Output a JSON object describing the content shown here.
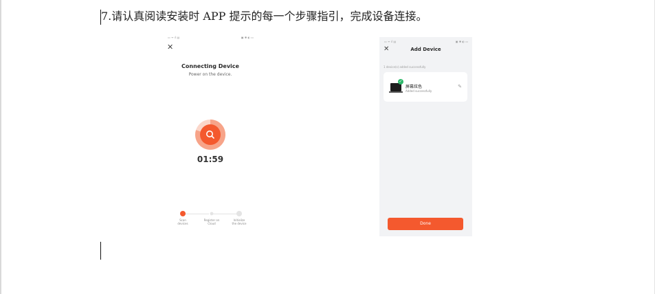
{
  "instruction": "7.请认真阅读安装时 APP 提示的每一个步骤指引，完成设备连接。",
  "left_screen": {
    "status_left": "▭ ᯤ ıl ▤",
    "status_right": "▣ ✱ ◐ ▭",
    "close_icon": "close-icon",
    "title": "Connecting Device",
    "subtitle": "Power on the device.",
    "search_icon": "search-icon",
    "timer": "01:59",
    "progress_ring_fraction": 0.8,
    "steps": [
      {
        "label": "Scan\ndevices",
        "state": "active"
      },
      {
        "label": "Register on\nCloud",
        "state": "pending"
      },
      {
        "label": "Initialize\nthe device",
        "state": "pending"
      }
    ]
  },
  "right_screen": {
    "status_left": "▭ ᯤ ıl ▤",
    "status_right": "▣ ✱ ◐ ▭",
    "close_icon": "close-icon",
    "title": "Add Device",
    "added_text": "1 device(s) added successfully",
    "device": {
      "name": "屏幕炫色",
      "status": "Added successfully",
      "check_icon": "check-icon",
      "edit_icon": "pencil-icon"
    },
    "done_label": "Done"
  },
  "colors": {
    "accent": "#f4592e",
    "success": "#2fb86b",
    "screen_bg": "#f2f3f5"
  }
}
